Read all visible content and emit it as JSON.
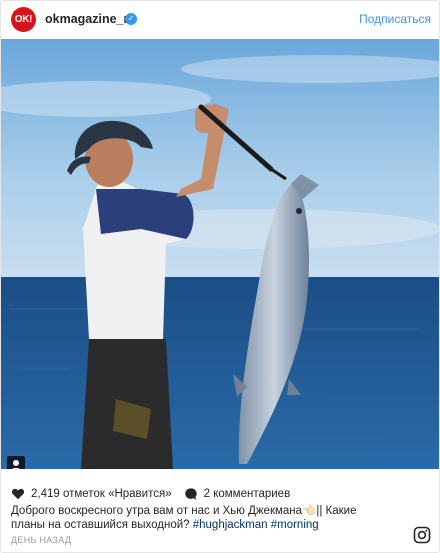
{
  "header": {
    "avatar_text": "OK!",
    "username": "okmagazine_ru",
    "verified_mark": "✓",
    "follow_label": "Подписаться"
  },
  "photo": {
    "alt": "",
    "badge_icon": "user-tag-icon"
  },
  "stats": {
    "likes_text": "2,419 отметок «Нравится»",
    "comments_text": "2 комментариев"
  },
  "caption": {
    "text": "Доброго воскресного утра вам от нас и Хью Джекмана👈🏻|| Какие планы на оставшийся выходной? ",
    "hashtags": "#hughjackman #morning"
  },
  "timestamp": "ДЕНЬ НАЗАД",
  "icons": {
    "like": "heart-icon",
    "comment": "comment-bubble-icon",
    "brand": "instagram-icon"
  },
  "colors": {
    "accent": "#3897f0",
    "brand": "#d7141a",
    "text": "#262626",
    "muted": "#999999"
  }
}
